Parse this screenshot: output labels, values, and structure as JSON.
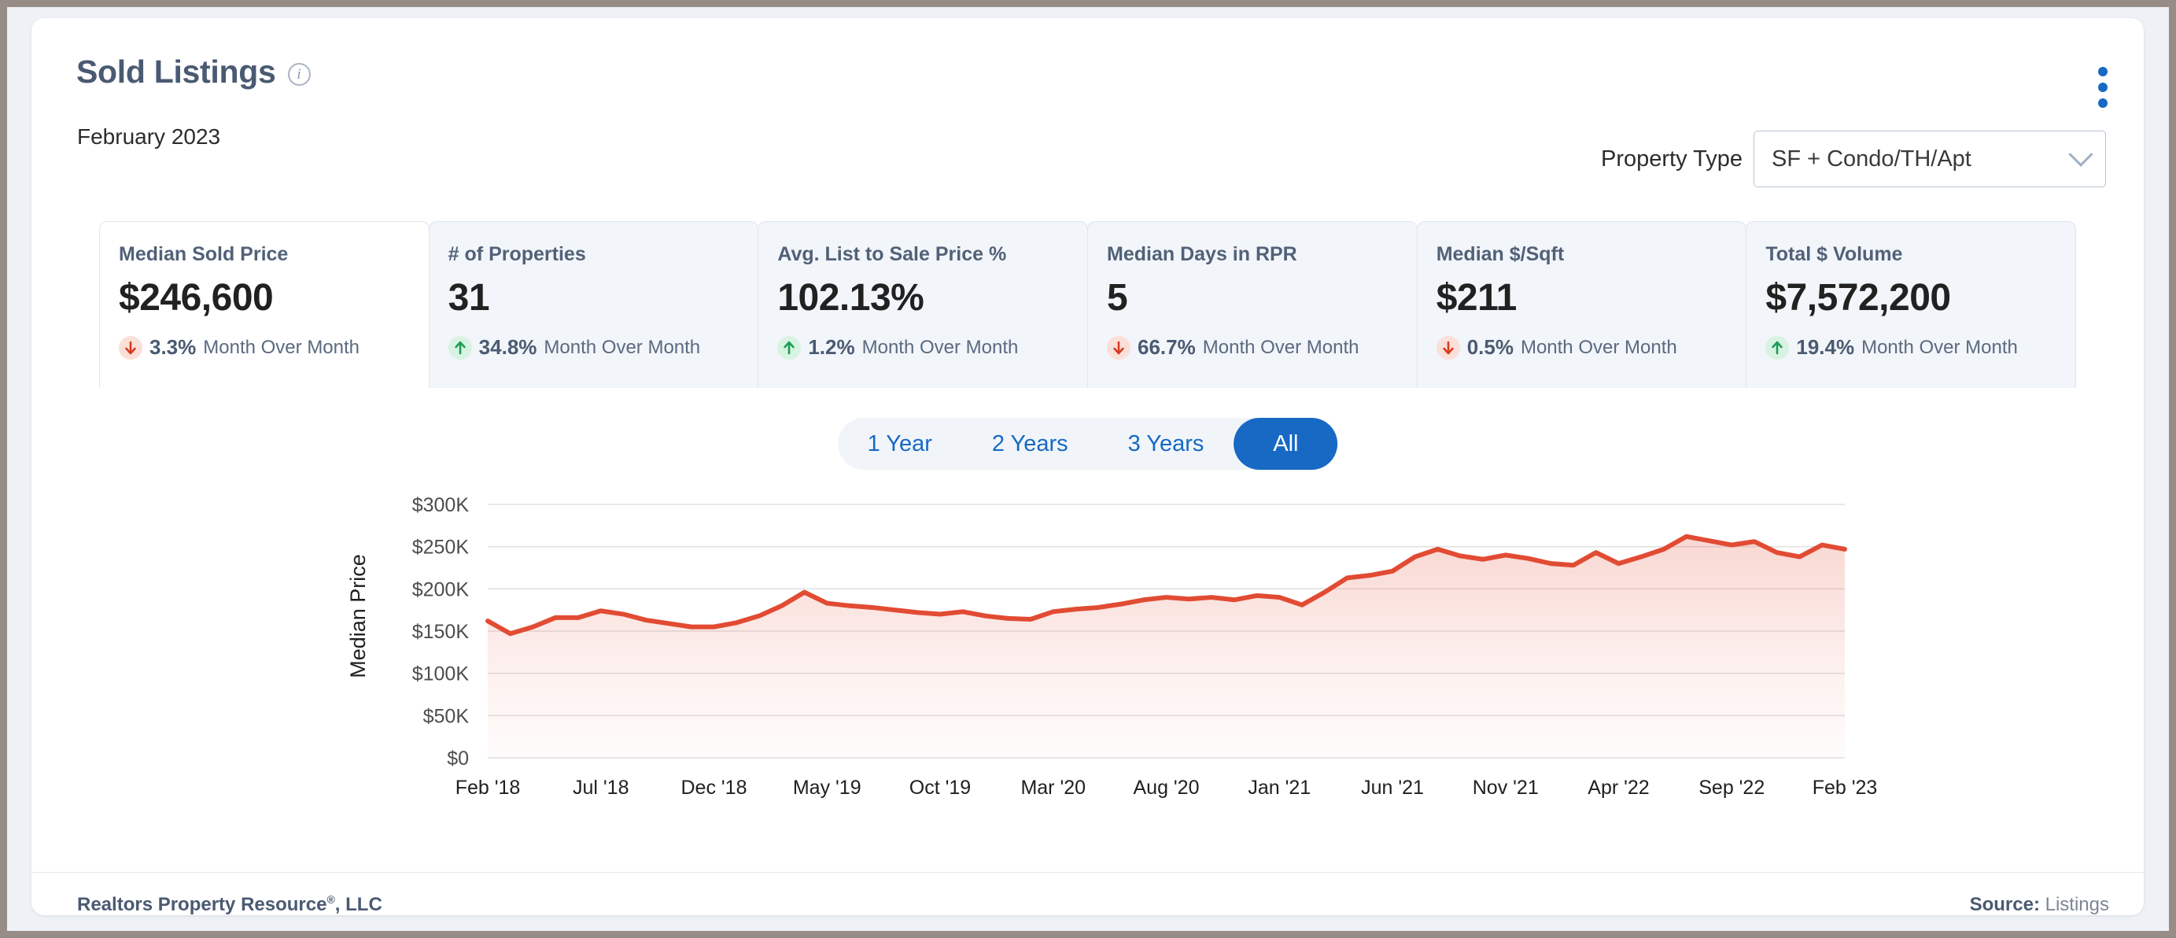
{
  "header": {
    "title": "Sold Listings",
    "info_icon": "info-icon",
    "subtitle": "February 2023",
    "menu_icon": "kebab-menu-icon"
  },
  "property_type": {
    "label": "Property Type",
    "value": "SF + Condo/TH/Apt",
    "chevron_icon": "chevron-down-icon"
  },
  "kpis": [
    {
      "label": "Median Sold Price",
      "value": "$246,600",
      "direction": "down",
      "pct": "3.3%",
      "period": "Month Over Month",
      "active": true
    },
    {
      "label": "# of Properties",
      "value": "31",
      "direction": "up",
      "pct": "34.8%",
      "period": "Month Over Month",
      "active": false
    },
    {
      "label": "Avg. List to Sale Price %",
      "value": "102.13%",
      "direction": "up",
      "pct": "1.2%",
      "period": "Month Over Month",
      "active": false
    },
    {
      "label": "Median Days in RPR",
      "value": "5",
      "direction": "down",
      "pct": "66.7%",
      "period": "Month Over Month",
      "active": false
    },
    {
      "label": "Median $/Sqft",
      "value": "$211",
      "direction": "down",
      "pct": "0.5%",
      "period": "Month Over Month",
      "active": false
    },
    {
      "label": "Total $ Volume",
      "value": "$7,572,200",
      "direction": "up",
      "pct": "19.4%",
      "period": "Month Over Month",
      "active": false
    }
  ],
  "range_buttons": [
    {
      "label": "1 Year",
      "active": false
    },
    {
      "label": "2 Years",
      "active": false
    },
    {
      "label": "3 Years",
      "active": false
    },
    {
      "label": "All",
      "active": true
    }
  ],
  "footer": {
    "left_text": "Realtors Property Resource",
    "left_suffix": ", LLC",
    "source_label": "Source:",
    "source_value": "Listings"
  },
  "colors": {
    "brand_blue": "#1769c4",
    "title_slate": "#4a5a72",
    "line_red": "#e24b33",
    "up_green": "#1e9d55",
    "down_red": "#d93b1e",
    "card_bg": "#f2f5f9",
    "page_bg": "#eef1f5"
  },
  "chart_data": {
    "type": "area",
    "title": "",
    "xlabel": "",
    "ylabel": "Median Price",
    "ylim": [
      0,
      300000
    ],
    "ytick_labels": [
      "$0",
      "$50K",
      "$100K",
      "$150K",
      "$200K",
      "$250K",
      "$300K"
    ],
    "ytick_values": [
      0,
      50000,
      100000,
      150000,
      200000,
      250000,
      300000
    ],
    "grid": true,
    "legend": "none",
    "line_color": "#e24b33",
    "fill": "gradient red to transparent",
    "xtick_labels": [
      "Feb '18",
      "Jul '18",
      "Dec '18",
      "May '19",
      "Oct '19",
      "Mar '20",
      "Aug '20",
      "Jan '21",
      "Jun '21",
      "Nov '21",
      "Apr '22",
      "Sep '22",
      "Feb '23"
    ],
    "xtick_indices": [
      0,
      5,
      10,
      15,
      20,
      25,
      30,
      35,
      40,
      45,
      50,
      55,
      60
    ],
    "x": [
      "Feb '18",
      "Mar '18",
      "Apr '18",
      "May '18",
      "Jun '18",
      "Jul '18",
      "Aug '18",
      "Sep '18",
      "Oct '18",
      "Nov '18",
      "Dec '18",
      "Jan '19",
      "Feb '19",
      "Mar '19",
      "Apr '19",
      "May '19",
      "Jun '19",
      "Jul '19",
      "Aug '19",
      "Sep '19",
      "Oct '19",
      "Nov '19",
      "Dec '19",
      "Jan '20",
      "Feb '20",
      "Mar '20",
      "Apr '20",
      "May '20",
      "Jun '20",
      "Jul '20",
      "Aug '20",
      "Sep '20",
      "Oct '20",
      "Nov '20",
      "Dec '20",
      "Jan '21",
      "Feb '21",
      "Mar '21",
      "Apr '21",
      "May '21",
      "Jun '21",
      "Jul '21",
      "Aug '21",
      "Sep '21",
      "Oct '21",
      "Nov '21",
      "Dec '21",
      "Jan '22",
      "Feb '22",
      "Mar '22",
      "Apr '22",
      "May '22",
      "Jun '22",
      "Jul '22",
      "Aug '22",
      "Sep '22",
      "Oct '22",
      "Nov '22",
      "Dec '22",
      "Jan '23",
      "Feb '23"
    ],
    "series": [
      {
        "name": "Median Price",
        "values": [
          162000,
          147000,
          155000,
          166000,
          166000,
          174000,
          170000,
          163000,
          159000,
          155000,
          155000,
          160000,
          168000,
          180000,
          196000,
          183000,
          180000,
          178000,
          175000,
          172000,
          170000,
          173000,
          168000,
          165000,
          164000,
          173000,
          176000,
          178000,
          182000,
          187000,
          190000,
          188000,
          190000,
          187000,
          192000,
          190000,
          181000,
          196000,
          213000,
          216000,
          221000,
          238000,
          247000,
          239000,
          235000,
          240000,
          236000,
          230000,
          228000,
          243000,
          230000,
          238000,
          247000,
          262000,
          257000,
          252000,
          256000,
          243000,
          238000,
          252000,
          247000
        ]
      }
    ]
  }
}
